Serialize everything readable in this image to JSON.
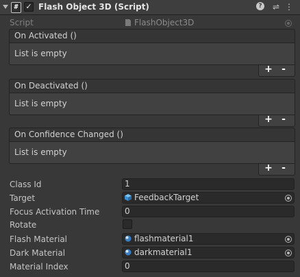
{
  "component": {
    "title": "Flash Object 3D (Script)",
    "enabled": true,
    "icon_glyph": "#",
    "icons": [
      "foldout-arrow",
      "script-icon",
      "help-icon",
      "presets-icon",
      "more-menu-icon"
    ]
  },
  "script": {
    "label": "Script",
    "value": "FlashObject3D"
  },
  "events": [
    {
      "label": "On Activated ()",
      "empty_text": "List is empty",
      "add": "+",
      "remove": "-"
    },
    {
      "label": "On Deactivated ()",
      "empty_text": "List is empty",
      "add": "+",
      "remove": "-"
    },
    {
      "label": "On Confidence Changed ()",
      "empty_text": "List is empty",
      "add": "+",
      "remove": "-"
    }
  ],
  "fields": {
    "class_id": {
      "label": "Class Id",
      "value": "1"
    },
    "target": {
      "label": "Target",
      "value": "FeedbackTarget"
    },
    "focus_activation_time": {
      "label": "Focus Activation Time",
      "value": "0"
    },
    "rotate": {
      "label": "Rotate",
      "checked": false
    },
    "flash_material": {
      "label": "Flash Material",
      "value": "flashmaterial1"
    },
    "dark_material": {
      "label": "Dark Material",
      "value": "darkmaterial1"
    },
    "material_index": {
      "label": "Material Index",
      "value": "0"
    }
  },
  "header_icons": {
    "help": "?",
    "presets": "⇌",
    "menu": "⋮",
    "check": "✓"
  },
  "colors": {
    "background": "#383838",
    "field": "#2a2a2a",
    "header": "#3e3e3e",
    "cube_icon": "#4aa3e0"
  }
}
